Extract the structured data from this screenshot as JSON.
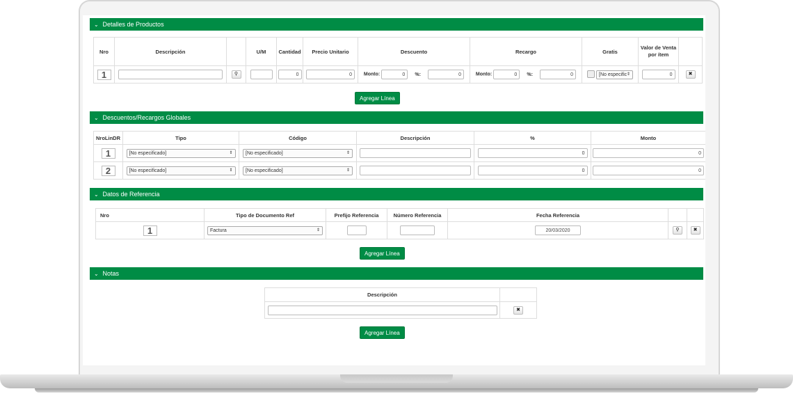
{
  "sections": {
    "products": {
      "title": "Detalles de Productos"
    },
    "global": {
      "title": "Descuentos/Recargos Globales"
    },
    "reference": {
      "title": "Datos de Referencia"
    },
    "notes": {
      "title": "Notas"
    }
  },
  "products": {
    "headers": {
      "nro": "Nro",
      "descripcion": "Descripción",
      "um": "U/M",
      "cantidad": "Cantidad",
      "precio": "Precio Unitario",
      "descuento": "Descuento",
      "recargo": "Recargo",
      "gratis": "Gratis",
      "valor": "Valor de Venta por ítem"
    },
    "row": {
      "nro": "1",
      "cantidad": "0",
      "precio": "0",
      "descuento_label_monto": "Monto:",
      "descuento_monto": "0",
      "descuento_label_pct": "%:",
      "descuento_pct": "0",
      "recargo_label_monto": "Monto:",
      "recargo_monto": "0",
      "recargo_label_pct": "%:",
      "recargo_pct": "0",
      "gratis_select": "[No especific",
      "valor": "0"
    },
    "add_label": "Agregar Línea"
  },
  "global": {
    "headers": {
      "nro": "NroLinDR",
      "tipo": "Tipo",
      "codigo": "Código",
      "descripcion": "Descripción",
      "pct": "%",
      "monto": "Monto"
    },
    "rows": [
      {
        "nro": "1",
        "tipo": "[No especificado]",
        "codigo": "[No especificado]",
        "pct": "0",
        "monto": "0"
      },
      {
        "nro": "2",
        "tipo": "[No especificado]",
        "codigo": "[No especificado]",
        "pct": "0",
        "monto": "0"
      }
    ]
  },
  "reference": {
    "headers": {
      "nro": "Nro",
      "tipo": "Tipo de Documento Ref",
      "prefijo": "Prefijo Referencia",
      "numero": "Número Referencia",
      "fecha": "Fecha Referencia"
    },
    "row": {
      "nro": "1",
      "tipo": "Factura",
      "fecha": "20/03/2020"
    },
    "add_label": "Agregar Línea"
  },
  "notes": {
    "headers": {
      "descripcion": "Descripción"
    },
    "add_label": "Agregar Línea"
  },
  "icons": {
    "collapse": "chevron-down-icon",
    "search": "search-icon",
    "remove": "close-icon",
    "select": "select-arrows-icon"
  },
  "colors": {
    "accent": "#008c45"
  }
}
